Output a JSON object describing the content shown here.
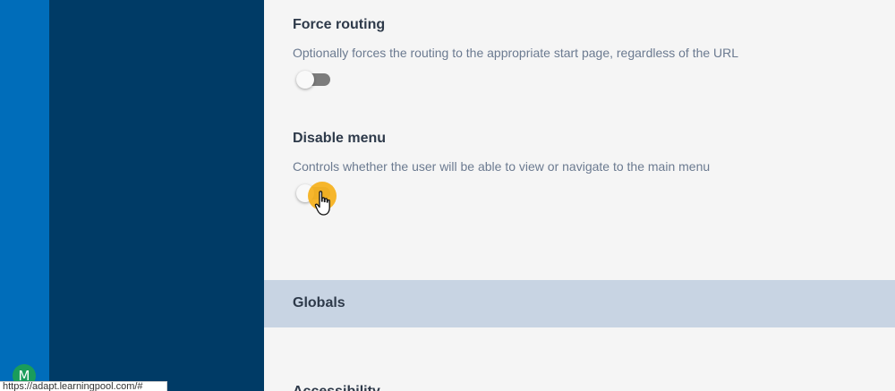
{
  "settings": [
    {
      "title": "Force routing",
      "description": "Optionally forces the routing to the appropriate start page, regardless of the URL",
      "enabled": false
    },
    {
      "title": "Disable menu",
      "description": "Controls whether the user will be able to view or navigate to the main menu",
      "enabled": false
    }
  ],
  "section": {
    "title": "Globals"
  },
  "next_heading": "Accessibility",
  "avatar": {
    "initial": "M",
    "color": "#1a9c5b"
  },
  "status_url": "https://adapt.learningpool.com/#",
  "colors": {
    "rail": "#006dba",
    "sidepanel": "#003b66",
    "section_bar": "#c8d4e3",
    "highlight": "#f5b221"
  }
}
